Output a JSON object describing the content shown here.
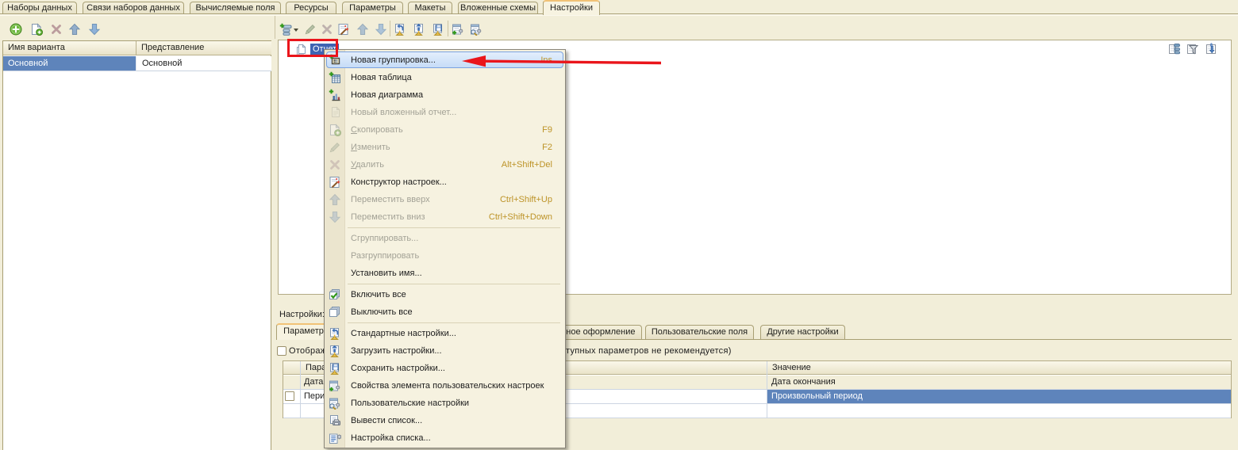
{
  "top_tabs": {
    "items": [
      {
        "label": "Наборы данных"
      },
      {
        "label": "Связи наборов данных"
      },
      {
        "label": "Вычисляемые поля"
      },
      {
        "label": "Ресурсы"
      },
      {
        "label": "Параметры"
      },
      {
        "label": "Макеты"
      },
      {
        "label": "Вложенные схемы"
      },
      {
        "label": "Настройки"
      }
    ],
    "active": "Настройки"
  },
  "variants_panel": {
    "toolbar": {
      "buttons": [
        {
          "name": "add",
          "icon": "add-icon",
          "enabled": true
        },
        {
          "name": "add-copy",
          "icon": "copy-add-icon",
          "enabled": true
        },
        {
          "name": "delete",
          "icon": "delete-icon",
          "enabled": false
        },
        {
          "name": "move-up",
          "icon": "move-up-icon",
          "enabled": false
        },
        {
          "name": "move-down",
          "icon": "move-down-icon",
          "enabled": false
        }
      ]
    },
    "grid": {
      "columns": [
        "Имя варианта",
        "Представление"
      ],
      "rows": [
        {
          "name": "Основной",
          "presentation": "Основной",
          "selected": true
        }
      ]
    }
  },
  "settings_panel": {
    "toolbar": {
      "buttons": [
        {
          "name": "add",
          "icon": "add-item-icon",
          "has_dropdown": true,
          "enabled": true
        },
        {
          "name": "edit",
          "icon": "pencil-icon",
          "enabled": false
        },
        {
          "name": "delete",
          "icon": "delete-icon",
          "enabled": false
        },
        {
          "name": "settings-constructor",
          "icon": "constructor-icon",
          "enabled": true
        },
        {
          "name": "move-up",
          "icon": "move-up-icon",
          "enabled": false
        },
        {
          "name": "move-down",
          "icon": "move-down-icon",
          "enabled": false
        },
        {
          "name": "standard-settings",
          "icon": "standard-settings-icon",
          "enabled": true
        },
        {
          "name": "load-settings",
          "icon": "load-settings-icon",
          "enabled": true
        },
        {
          "name": "save-settings",
          "icon": "save-settings-icon",
          "enabled": true
        },
        {
          "name": "user-settings-item-properties",
          "icon": "user-settings-properties-icon",
          "enabled": true
        },
        {
          "name": "user-settings",
          "icon": "user-settings-icon",
          "enabled": true
        }
      ]
    },
    "tree": {
      "root_label": "Отчет",
      "root_selected": true,
      "header_icons": [
        "structure-icon",
        "filter-icon",
        "sort-icon"
      ]
    },
    "settings_label": "Настройки:",
    "settings_tabs": {
      "items": [
        {
          "label": "Параметры"
        },
        {
          "label": "Условное оформление"
        },
        {
          "label": "Пользовательские поля"
        },
        {
          "label": "Другие настройки"
        }
      ],
      "active": "Параметры"
    },
    "show_unavailable": {
      "label": "Отображать недоступные параметры (установка значений недоступных параметров не рекомендуется)",
      "checked": false
    },
    "parameters_table": {
      "columns": [
        "",
        "Параметр",
        "Значение"
      ],
      "rows": [
        {
          "use": null,
          "parameter": "Дата",
          "value": "Дата окончания",
          "unavailable": true
        },
        {
          "use": false,
          "parameter": "Период",
          "value": "Произвольный период",
          "value_selected": true
        },
        {
          "use": null,
          "parameter": "",
          "value": ""
        }
      ]
    }
  },
  "context_menu": {
    "items": [
      {
        "lead": "",
        "label": "Новая группировка...",
        "shortcut": "Ins",
        "enabled": true,
        "highlighted": true,
        "icon": "new-grouping-icon"
      },
      {
        "lead": "",
        "label": "Новая таблица",
        "shortcut": "",
        "enabled": true,
        "icon": "new-table-icon"
      },
      {
        "lead": "",
        "label": "Новая диаграмма",
        "shortcut": "",
        "enabled": true,
        "icon": "new-chart-icon"
      },
      {
        "lead": "",
        "label": "Новый вложенный отчет...",
        "shortcut": "",
        "enabled": false,
        "icon": "nested-report-icon"
      },
      {
        "lead": "С",
        "label": "копировать",
        "shortcut": "F9",
        "enabled": false,
        "icon": "copy-add-icon"
      },
      {
        "lead": "И",
        "label": "зменить",
        "shortcut": "F2",
        "enabled": false,
        "icon": "pencil-icon"
      },
      {
        "lead": "У",
        "label": "далить",
        "shortcut": "Alt+Shift+Del",
        "enabled": false,
        "icon": "delete-icon"
      },
      {
        "lead": "",
        "label": "Конструктор настроек...",
        "shortcut": "",
        "enabled": true,
        "icon": "constructor-icon"
      },
      {
        "lead": "",
        "label": "Переместить вверх",
        "shortcut": "Ctrl+Shift+Up",
        "enabled": false,
        "icon": "move-up-icon"
      },
      {
        "lead": "",
        "label": "Переместить вниз",
        "shortcut": "Ctrl+Shift+Down",
        "enabled": false,
        "icon": "move-down-icon"
      },
      {
        "lead": "",
        "label": "Сгруппировать...",
        "shortcut": "",
        "enabled": false,
        "icon": ""
      },
      {
        "lead": "",
        "label": "Разгруппировать",
        "shortcut": "",
        "enabled": false,
        "icon": ""
      },
      {
        "lead": "",
        "label": "Установить имя...",
        "shortcut": "",
        "enabled": true,
        "icon": ""
      },
      {
        "lead": "",
        "label": "Включить все",
        "shortcut": "",
        "enabled": true,
        "icon": "enable-all-icon"
      },
      {
        "lead": "",
        "label": "Выключить все",
        "shortcut": "",
        "enabled": true,
        "icon": "disable-all-icon"
      },
      {
        "lead": "",
        "label": "Стандартные настройки...",
        "shortcut": "",
        "enabled": true,
        "icon": "standard-settings-icon"
      },
      {
        "lead": "",
        "label": "Загрузить настройки...",
        "shortcut": "",
        "enabled": true,
        "icon": "load-settings-icon"
      },
      {
        "lead": "",
        "label": "Сохранить настройки...",
        "shortcut": "",
        "enabled": true,
        "icon": "save-settings-icon"
      },
      {
        "lead": "",
        "label": "Свойства элемента пользовательских настроек",
        "shortcut": "",
        "enabled": true,
        "icon": "user-settings-properties-icon"
      },
      {
        "lead": "",
        "label": "Пользовательские настройки",
        "shortcut": "",
        "enabled": true,
        "icon": "user-settings-icon"
      },
      {
        "lead": "",
        "label": "Вывести список...",
        "shortcut": "",
        "enabled": true,
        "icon": "print-list-icon"
      },
      {
        "lead": "",
        "label": "Настройка списка...",
        "shortcut": "",
        "enabled": true,
        "icon": "list-settings-icon"
      }
    ]
  },
  "annotations": {
    "color": "#ea151b",
    "box_target": "report-tree-node",
    "arrow_target": "menu-item-new-grouping"
  },
  "colors": {
    "form_background": "#f2eed9",
    "selection_blue": "#5e84bb",
    "tree_selection_blue": "#3f63b2",
    "menu_highlight": "#c6dcf7",
    "shortcut_gold": "#bd9327",
    "annotation_red": "#ea151b"
  }
}
